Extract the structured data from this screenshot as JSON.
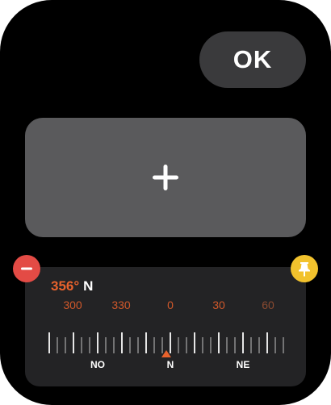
{
  "ok_button": {
    "label": "OK"
  },
  "add_tile": {
    "icon": "plus-icon"
  },
  "compass": {
    "heading_degrees": "356°",
    "heading_direction": "N",
    "accent_color": "#e8622c",
    "scale_labels": [
      "300",
      "330",
      "0",
      "30",
      "60"
    ],
    "cardinals": [
      "NO",
      "N",
      "NE"
    ]
  },
  "controls": {
    "remove_icon": "minus-icon",
    "remove_color": "#e34b45",
    "pin_icon": "pin-icon",
    "pin_color": "#f2c22d"
  }
}
